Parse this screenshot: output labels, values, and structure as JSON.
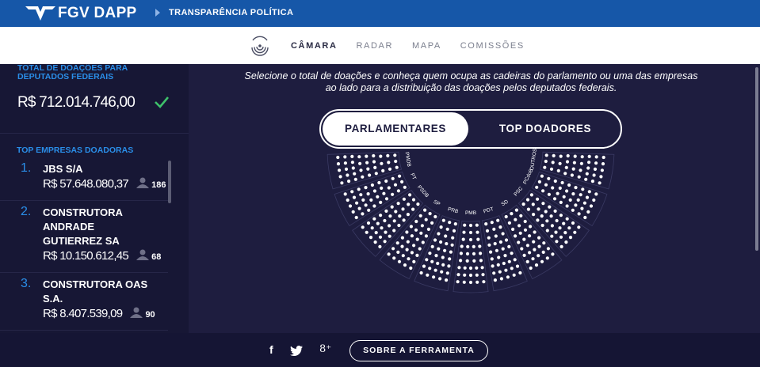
{
  "header": {
    "brand": "FGV DAPP",
    "subtitle": "TRANSPARÊNCIA POLÍTICA"
  },
  "nav": {
    "items": [
      {
        "label": "CÂMARA",
        "active": true
      },
      {
        "label": "RADAR",
        "active": false
      },
      {
        "label": "MAPA",
        "active": false
      },
      {
        "label": "COMISSÕES",
        "active": false
      }
    ]
  },
  "sidebar": {
    "total_label": "TOTAL DE DOAÇÕES PARA DEPUTADOS FEDERAIS",
    "total_value": "R$ 712.014.746,00",
    "top_label": "TOP EMPRESAS DOADORAS",
    "donors": [
      {
        "rank": "1.",
        "name": "JBS S/A",
        "amount": "R$ 57.648.080,37",
        "count": "186"
      },
      {
        "rank": "2.",
        "name": "CONSTRUTORA ANDRADE GUTIERREZ SA",
        "amount": "R$ 10.150.612,45",
        "count": "68"
      },
      {
        "rank": "3.",
        "name": "CONSTRUTORA OAS S.A.",
        "amount": "R$ 8.407.539,09",
        "count": "90"
      }
    ]
  },
  "main": {
    "intro": "Selecione o total de doações e conheça quem ocupa as cadeiras do parlamento ou uma das empresas ao lado para a distribuição das doações pelos deputados federais.",
    "toggle_left": "PARLAMENTARES",
    "toggle_right": "TOP DOADORES",
    "parties": [
      "PMDB",
      "PT",
      "PSDB",
      "SP",
      "PRB",
      "PMB",
      "PDT",
      "SD",
      "PSC",
      "PCdoB",
      "OUTROS"
    ]
  },
  "footer": {
    "facebook": "f",
    "twitter": "twitter-icon",
    "gplus": "8⁺",
    "about": "SOBRE A FERRAMENTA"
  },
  "colors": {
    "accent_blue": "#2a8ee8",
    "header_blue": "#1657a8",
    "background": "#1e1d3f",
    "check_green": "#3ec26b"
  }
}
